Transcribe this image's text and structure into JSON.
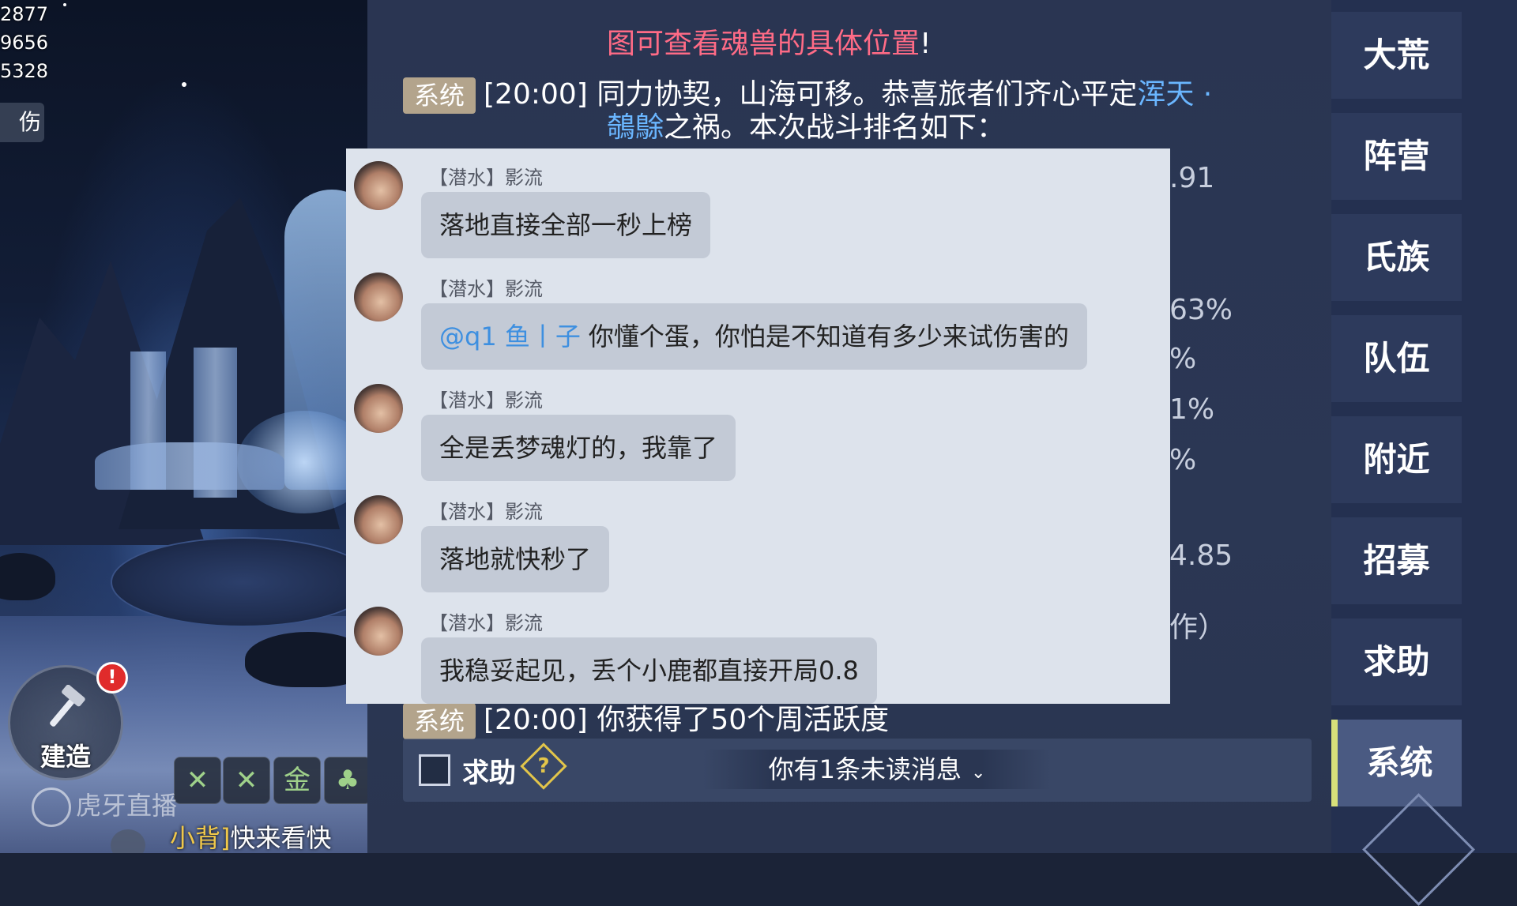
{
  "game": {
    "stats": [
      "2877",
      "9656",
      "5328"
    ],
    "damage_label": "伤",
    "build_label": "建造",
    "build_alert": "!",
    "skill_gold": "金",
    "watermark": "虎牙直播",
    "bottom_chat_tag": "小背]",
    "bottom_chat_text": "快来看快"
  },
  "chat": {
    "lines": [
      {
        "pink": "图可查看魂兽的具体位置",
        "suffix": "!"
      },
      {
        "tag": "系统",
        "time": "[20:00]",
        "text": "同力协契，山海可移。恭喜旅者们齐心平定",
        "cyan": "浑天 ·"
      },
      {
        "cyan": "鵸鵌",
        "text": "之祸。本次战斗排名如下："
      },
      {
        "tag": "系统",
        "time": "[20:00]",
        "text": "你获得了50个周活跃度"
      }
    ],
    "side_values": [
      ".91",
      "63%",
      "%",
      "1%",
      "%",
      "4.85",
      "作）"
    ],
    "help_label": "求助",
    "help_icon": "?",
    "unread": "你有1条未读消息",
    "unread_chevron": "⌄"
  },
  "tabs": [
    "大荒",
    "阵营",
    "氏族",
    "队伍",
    "附近",
    "招募",
    "求助",
    "系统"
  ],
  "active_tab": "系统",
  "overlay": {
    "messages": [
      {
        "name": "【潜水】影流",
        "text": "落地直接全部一秒上榜"
      },
      {
        "name": "【潜水】影流",
        "mention": "@q1 鱼丨子",
        "text": "你懂个蛋，你怕是不知道有多少来试伤害的"
      },
      {
        "name": "【潜水】影流",
        "text": "全是丢梦魂灯的，我靠了"
      },
      {
        "name": "【潜水】影流",
        "text": "落地就快秒了"
      },
      {
        "name": "【潜水】影流",
        "text": "我稳妥起见，丢个小鹿都直接开局0.8"
      }
    ]
  }
}
